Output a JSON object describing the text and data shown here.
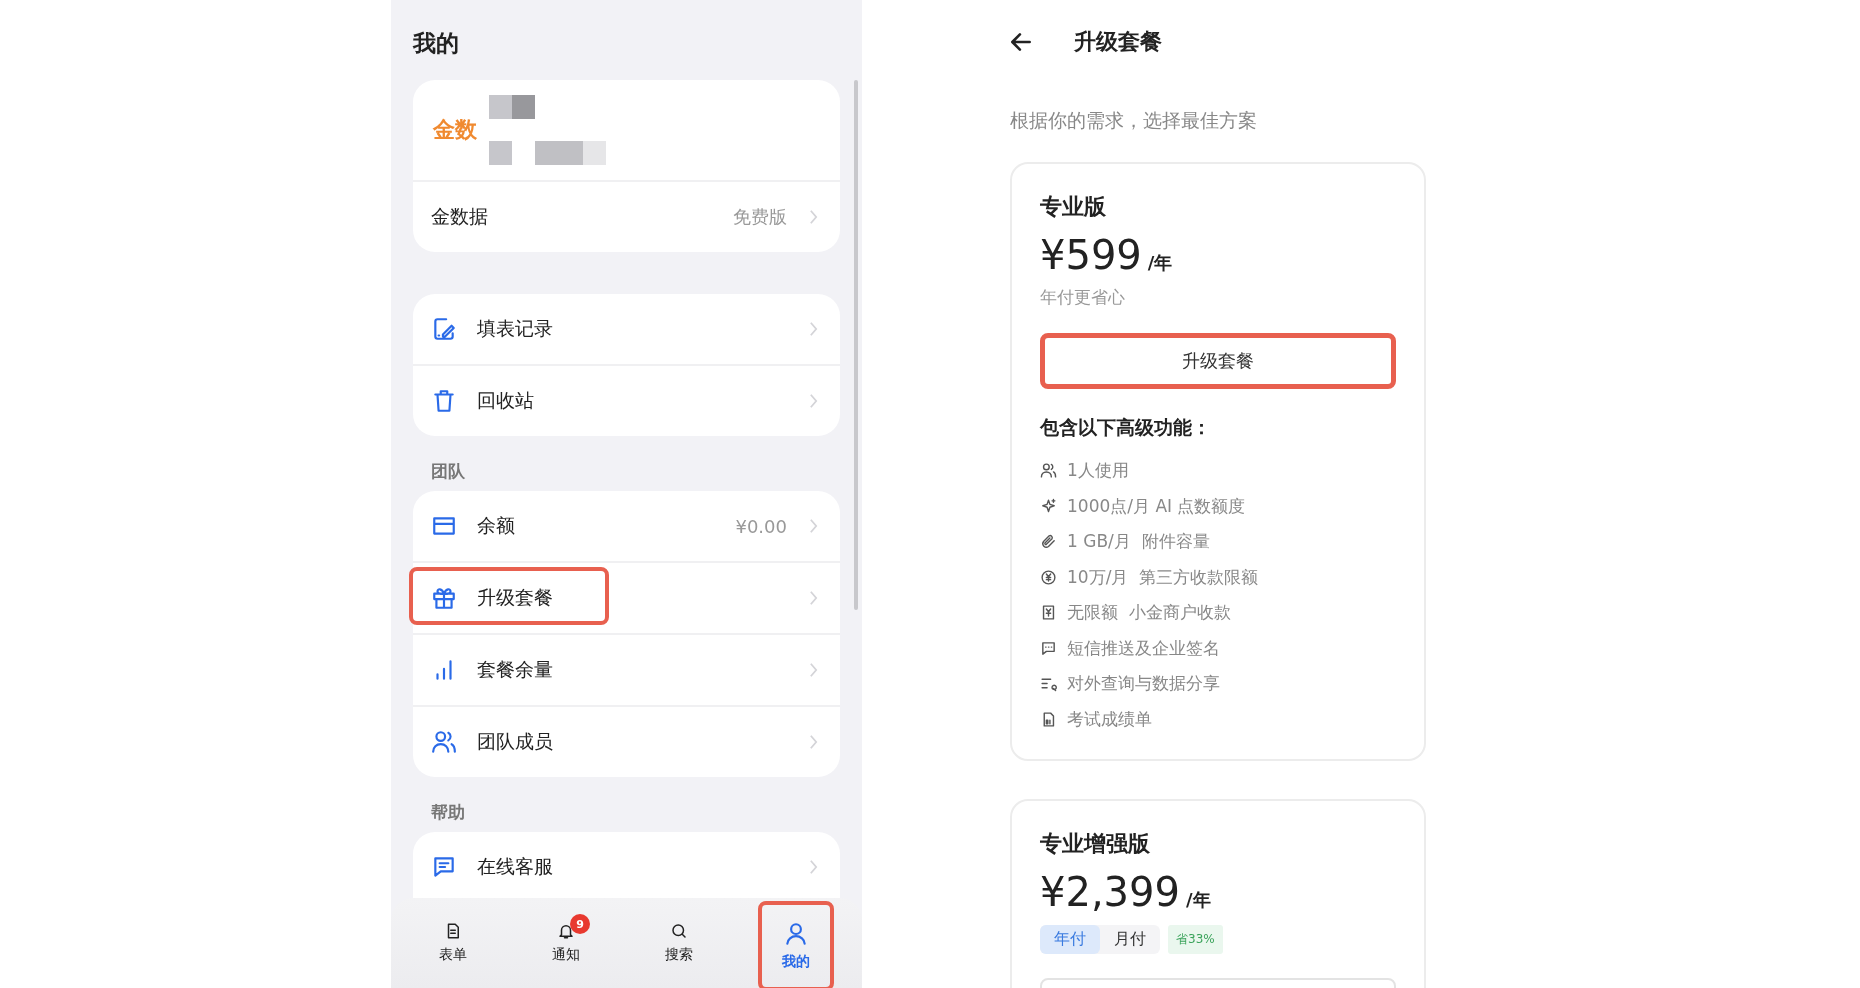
{
  "left": {
    "title": "我的",
    "profile": {
      "logo": "金数",
      "app_name": "金数据",
      "plan": "免费版"
    },
    "groups": [
      {
        "items": [
          {
            "label": "填表记录",
            "highlighted": false
          },
          {
            "label": "回收站",
            "highlighted": false
          }
        ]
      },
      {
        "heading": "团队",
        "items": [
          {
            "label": "余额",
            "value": "¥0.00",
            "highlighted": false
          },
          {
            "label": "升级套餐",
            "highlighted": true
          },
          {
            "label": "套餐余量",
            "highlighted": false
          },
          {
            "label": "团队成员",
            "highlighted": false
          }
        ]
      },
      {
        "heading": "帮助",
        "items": [
          {
            "label": "在线客服",
            "highlighted": false
          }
        ]
      }
    ],
    "tabbar": [
      {
        "label": "表单",
        "selected": false,
        "highlighted": false
      },
      {
        "label": "通知",
        "badge": "9",
        "selected": false,
        "highlighted": false
      },
      {
        "label": "搜索",
        "selected": false,
        "highlighted": false
      },
      {
        "label": "我的",
        "selected": true,
        "highlighted": true
      }
    ]
  },
  "right": {
    "title": "升级套餐",
    "subtitle": "根据你的需求，选择最佳方案",
    "plans": [
      {
        "name": "专业版",
        "price": "¥599",
        "unit": "/年",
        "note": "年付更省心",
        "button": {
          "label": "升级套餐",
          "highlighted": true
        },
        "features_heading": "包含以下高级功能：",
        "features": [
          "1人使用",
          "1000点/月 AI 点数额度",
          "1 GB/月  附件容量",
          "10万/月  第三方收款限额",
          "无限额  小金商户收款",
          "短信推送及企业签名",
          "对外查询与数据分享",
          "考试成绩单"
        ]
      },
      {
        "name": "专业增强版",
        "price": "¥2,399",
        "unit": "/年",
        "billing": [
          {
            "label": "年付",
            "selected": true
          },
          {
            "label": "月付",
            "selected": false
          }
        ],
        "discount": "省33%",
        "button": {
          "highlighted": false
        }
      }
    ]
  }
}
